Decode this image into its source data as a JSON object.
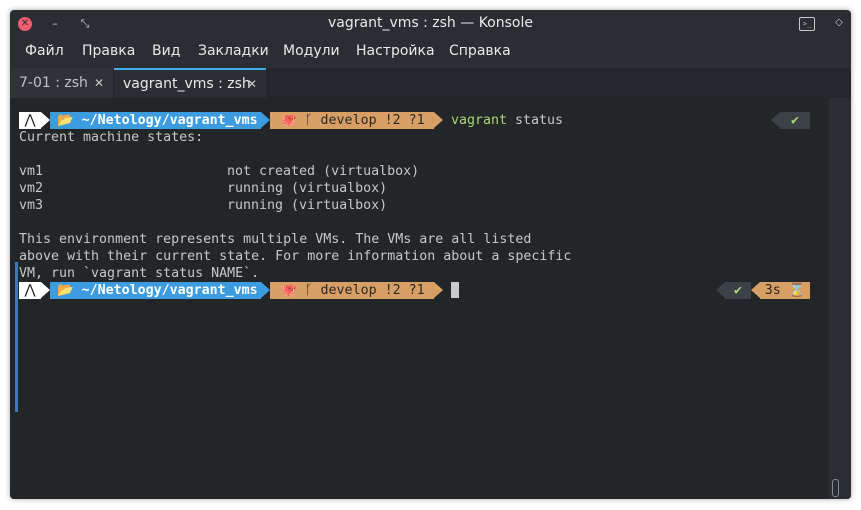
{
  "window": {
    "title": "vagrant_vms : zsh — Konsole"
  },
  "menu": [
    "Файл",
    "Правка",
    "Вид",
    "Закладки",
    "Модули",
    "Настройка",
    "Справка"
  ],
  "tabs": [
    {
      "label": "7-01 : zsh"
    },
    {
      "label": "vagrant_vms : zsh"
    }
  ],
  "prompt": {
    "os_glyph": "⋀",
    "path": "📂 ~/Netology/vagrant_vms ",
    "git": "🐙 ᚴ develop !2 ?1 "
  },
  "command": {
    "name": "vagrant",
    "args": " status"
  },
  "right_status_1": {
    "ok": "✔"
  },
  "right_status_2": {
    "ok": "✔",
    "time": "3s ⌛"
  },
  "output": {
    "line1": "Current machine states:",
    "vms": [
      {
        "name": "vm1",
        "state": "not created (virtualbox)"
      },
      {
        "name": "vm2",
        "state": "running (virtualbox)"
      },
      {
        "name": "vm3",
        "state": "running (virtualbox)"
      }
    ],
    "msg": [
      "This environment represents multiple VMs. The VMs are all listed",
      "above with their current state. For more information about a specific",
      "VM, run `vagrant status NAME`."
    ]
  },
  "colors": {
    "accent": "#3daee9",
    "dir_segment": "#3d9be0",
    "git_segment": "#d79f64",
    "command": "#a8d676",
    "terminal_bg": "#232629"
  },
  "icons": [
    "close-icon",
    "minimize-icon",
    "maximize-icon",
    "terminal-app-icon",
    "pin-icon",
    "tab-close-icon",
    "arch-logo-icon",
    "folder-icon",
    "github-icon",
    "git-branch-icon",
    "check-icon",
    "hourglass-icon"
  ]
}
